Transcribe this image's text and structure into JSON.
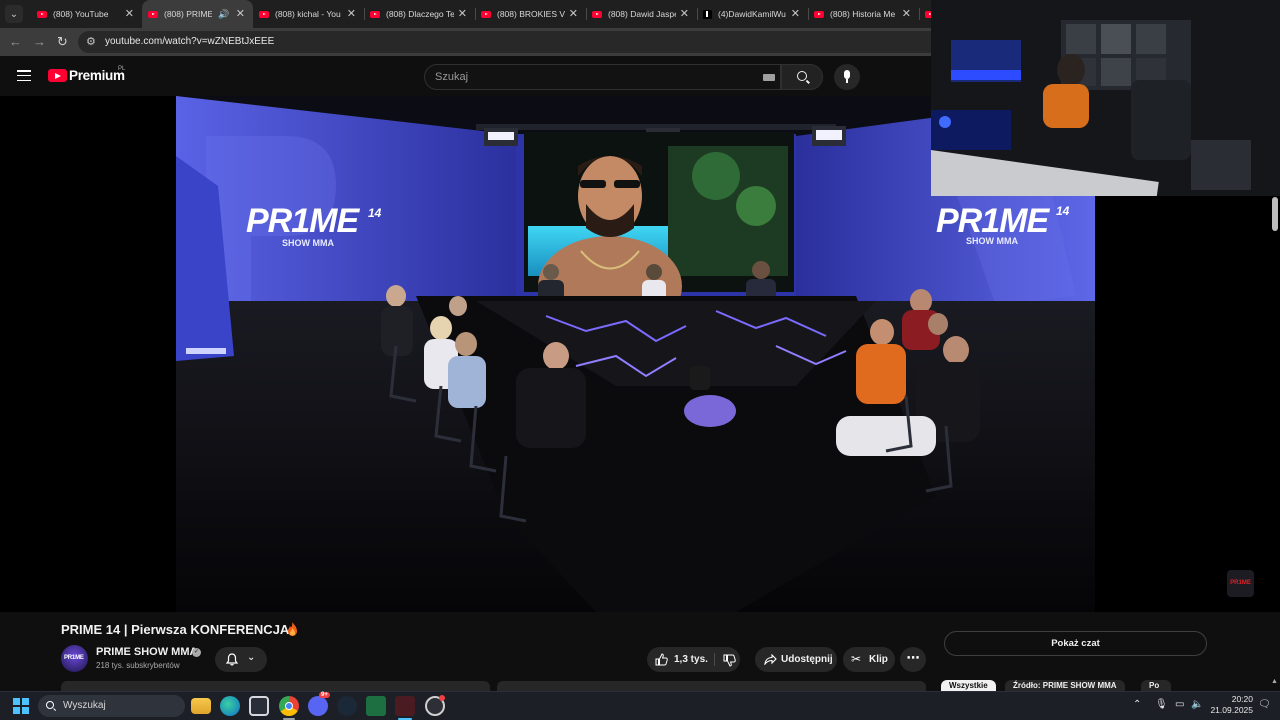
{
  "browser": {
    "tabs": [
      {
        "title": "(808) YouTube",
        "icon": "youtube-favicon-icon",
        "active": false
      },
      {
        "title": "(808) PRIME 1",
        "icon": "youtube-favicon-icon",
        "active": true,
        "audio": true
      },
      {
        "title": "(808) kichal - You",
        "icon": "youtube-favicon-icon",
        "active": false
      },
      {
        "title": "(808) Dlaczego Te",
        "icon": "youtube-favicon-icon",
        "active": false
      },
      {
        "title": "(808) BROKIES VS",
        "icon": "youtube-favicon-icon",
        "active": false
      },
      {
        "title": "(808) Dawid Jaspe",
        "icon": "youtube-favicon-icon",
        "active": false
      },
      {
        "title": "(4)DawidKamilWu",
        "icon": "tiktok-favicon-icon",
        "active": false
      },
      {
        "title": "(808) Historia Me",
        "icon": "youtube-favicon-icon",
        "active": false
      }
    ],
    "url": "youtube.com/watch?v=wZNEBtJxEEE"
  },
  "youtube": {
    "logo_text": "Premium",
    "region": "PL",
    "search_placeholder": "Szukaj"
  },
  "video": {
    "title": "PRIME 14 | Pierwsza KONFERENCJA",
    "title_emoji": "fire-icon",
    "stage_brand_left": "PR1ME",
    "stage_brand_left_num": "14",
    "stage_brand_left_sub": "SHOW MMA",
    "stage_brand_right": "PR1ME",
    "stage_brand_right_num": "14",
    "stage_brand_right_sub": "SHOW MMA",
    "corner_badge": "PR1ME"
  },
  "channel": {
    "name": "PRIME SHOW MMA",
    "subscribers": "218 tys. subskrybentów",
    "avatar_text": "PR1ME"
  },
  "actions": {
    "likes": "1,3 tys.",
    "share": "Udostępnij",
    "clip": "Klip"
  },
  "chat": {
    "show_chat": "Pokaż czat",
    "chips": [
      "Wszystkie",
      "Źródło: PRIME SHOW MMA",
      "Po"
    ]
  },
  "taskbar": {
    "search": "Wyszukaj",
    "time": "20:20",
    "date": "21.09.2025",
    "discord_badge": "9+"
  },
  "colors": {
    "yt_red": "#ff0033",
    "background": "#0f0f0f",
    "stage_blue": "#4a55d8",
    "taskbar": "#1c1f26"
  }
}
